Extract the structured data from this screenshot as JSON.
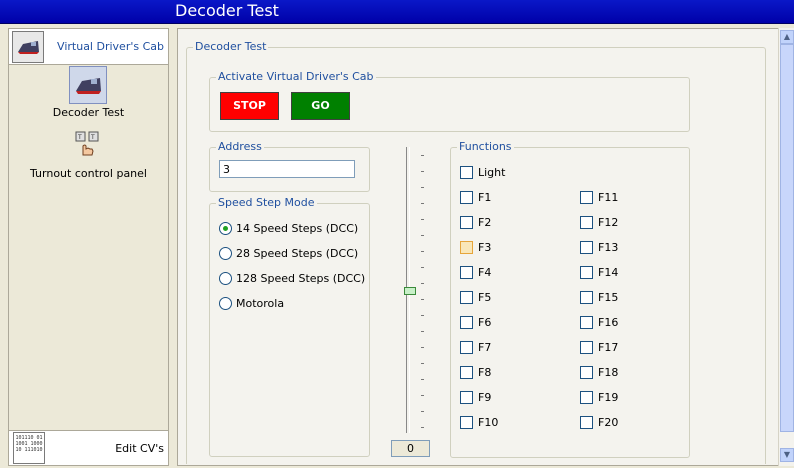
{
  "window": {
    "title": "Decoder Test"
  },
  "sidebar": {
    "header_label": "Virtual Driver's Cab",
    "items": [
      {
        "label": "Decoder Test"
      },
      {
        "label": "Turnout control panel"
      }
    ],
    "footer_label": "Edit CV's",
    "footer_icon_text": "101110 011001 100010 111010"
  },
  "main": {
    "panel_title": "Decoder Test",
    "activate_group": {
      "title": "Activate Virtual Driver's Cab",
      "stop_label": "STOP",
      "go_label": "GO"
    },
    "address_group": {
      "title": "Address",
      "value": "3"
    },
    "speed_group": {
      "title": "Speed Step Mode",
      "options": [
        {
          "label": "14 Speed Steps (DCC)",
          "selected": true
        },
        {
          "label": "28 Speed Steps (DCC)",
          "selected": false
        },
        {
          "label": "128 Speed Steps (DCC)",
          "selected": false
        },
        {
          "label": "Motorola",
          "selected": false
        }
      ]
    },
    "slider": {
      "value": "0"
    },
    "functions_group": {
      "title": "Functions",
      "light_label": "Light",
      "left": [
        "F1",
        "F2",
        "F3",
        "F4",
        "F5",
        "F6",
        "F7",
        "F8",
        "F9",
        "F10"
      ],
      "right": [
        "F11",
        "F12",
        "F13",
        "F14",
        "F15",
        "F16",
        "F17",
        "F18",
        "F19",
        "F20"
      ]
    }
  },
  "colors": {
    "stop": "#ff0000",
    "go": "#008000",
    "titlebar": "#0010b8",
    "legend": "#1f4f9f"
  },
  "icons": {
    "cab": "locomotive-icon",
    "turnout": "turnout-hand-icon",
    "cv": "binary-grid-icon",
    "scroll_up": "arrow-up-icon",
    "scroll_down": "arrow-down-icon"
  }
}
